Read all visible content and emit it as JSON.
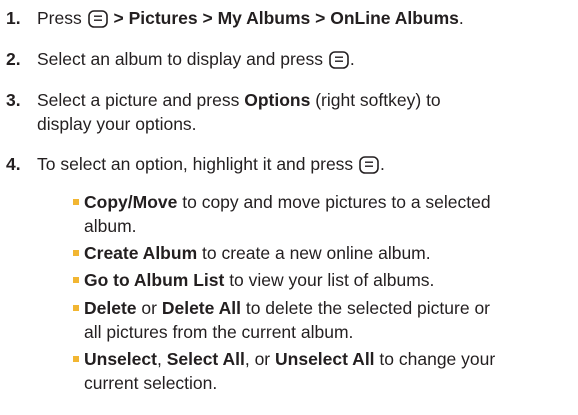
{
  "colors": {
    "text": "#231f20",
    "bullet": "#f2b632"
  },
  "icons": {
    "menu_ok_key": "menu-ok-key-icon"
  },
  "steps": [
    {
      "number": "1.",
      "parts": {
        "pre": "Press",
        "path": "> Pictures > My Albums > OnLine Albums",
        "end": "."
      }
    },
    {
      "number": "2.",
      "parts": {
        "pre": "Select an album to display and press",
        "end": "."
      }
    },
    {
      "number": "3.",
      "parts": {
        "pre": "Select a picture and press",
        "bold": "Options",
        "post": "(right softkey) to",
        "line2": "display your options."
      }
    },
    {
      "number": "4.",
      "parts": {
        "pre": "To select an option, highlight it and press",
        "end": "."
      }
    }
  ],
  "options": [
    {
      "b1": "Copy/Move",
      "t1": "to copy and move pictures to a selected",
      "line2": "album."
    },
    {
      "b1": "Create Album",
      "t1": "to create a new online album."
    },
    {
      "b1": "Go to Album List",
      "t1": "to view your list of albums."
    },
    {
      "b1": "Delete",
      "t1": "or",
      "b2": "Delete All",
      "t2": "to delete the selected picture or",
      "line2": "all pictures from the current album."
    },
    {
      "b1": "Unselect",
      "t1": ",",
      "b2": "Select All",
      "t2": ", or",
      "b3": "Unselect All",
      "t3": "to change your",
      "line2": "current selection."
    }
  ]
}
